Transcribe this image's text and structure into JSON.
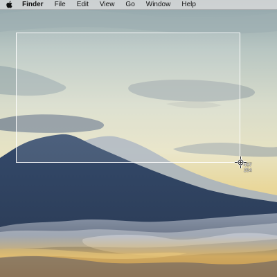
{
  "menubar": {
    "apple_icon": "apple-icon",
    "app_name": "Finder",
    "items": [
      "File",
      "Edit",
      "View",
      "Go",
      "Window",
      "Help"
    ]
  },
  "screenshot_tool": {
    "crosshair_icon": "crosshair-icon",
    "coord_x": "437",
    "coord_y": "254"
  },
  "desktop": {
    "wallpaper": "mountain-above-clouds-at-sunrise"
  }
}
